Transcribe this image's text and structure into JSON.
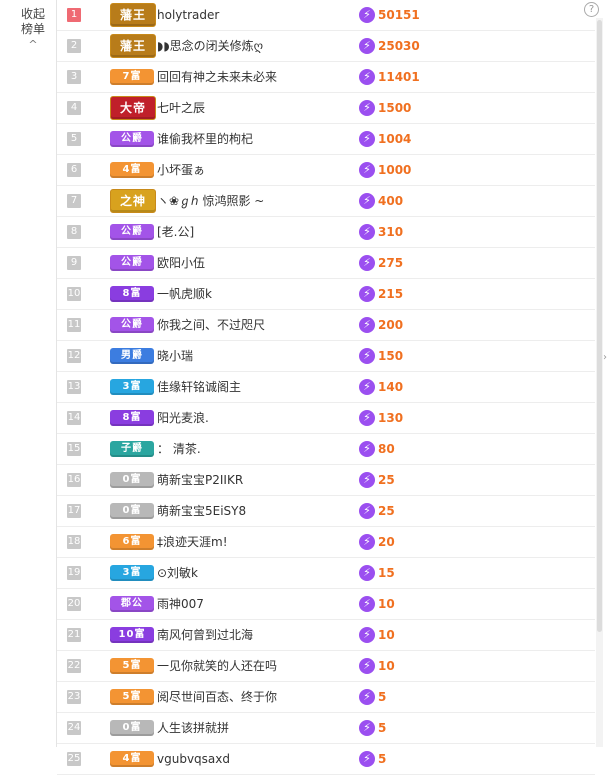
{
  "collapse": {
    "line1": "收起",
    "line2": "榜单",
    "chevron": "^"
  },
  "help_glyph": "?",
  "icons": {
    "help": "question-circle-icon",
    "value": "lightning-icon",
    "side": "chevron-right-icon",
    "collapse": "chevron-up-icon"
  },
  "colors": {
    "value_text": "#f07020",
    "top_rank": "#ef6a73",
    "rank": "#c8c8c8",
    "bolt": "#9b4ff0"
  },
  "ranking": [
    {
      "rank": "1",
      "badge": "藩王",
      "badge_color": "#b87c1a",
      "name": "holytrader",
      "value": "50151"
    },
    {
      "rank": "2",
      "badge": "藩王",
      "badge_color": "#b87c1a",
      "name": "◗◗思念の闭关修炼ღ",
      "value": "25030"
    },
    {
      "rank": "3",
      "badge": "7富",
      "badge_color": "#f39433",
      "name": "回回有神之未来未必来",
      "value": "11401"
    },
    {
      "rank": "4",
      "badge": "大帝",
      "badge_color": "#c0202a",
      "name": "七叶之辰",
      "value": "1500"
    },
    {
      "rank": "5",
      "badge": "公爵",
      "badge_color": "#a354e8",
      "name": "谁偷我杯里的枸杞",
      "value": "1004"
    },
    {
      "rank": "6",
      "badge": "4富",
      "badge_color": "#f39433",
      "name": "小坏蛋ぁ",
      "value": "1000"
    },
    {
      "rank": "7",
      "badge": "之神",
      "badge_color": "#d8a21e",
      "name": "ヽ❀ℊℎ 惊鸿照影 ~",
      "value": "400"
    },
    {
      "rank": "8",
      "badge": "公爵",
      "badge_color": "#a354e8",
      "name": "[老.公]",
      "value": "310"
    },
    {
      "rank": "9",
      "badge": "公爵",
      "badge_color": "#a354e8",
      "name": "欧阳小伍",
      "value": "275"
    },
    {
      "rank": "10",
      "badge": "8富",
      "badge_color": "#8a3de0",
      "name": "一帆虎顺k",
      "value": "215"
    },
    {
      "rank": "11",
      "badge": "公爵",
      "badge_color": "#a354e8",
      "name": "你我之间、不过咫尺",
      "value": "200"
    },
    {
      "rank": "12",
      "badge": "男爵",
      "badge_color": "#3c7de0",
      "name": "晓小瑞",
      "value": "150"
    },
    {
      "rank": "13",
      "badge": "3富",
      "badge_color": "#27a6e0",
      "name": "佳缘轩铭诚阁主",
      "value": "140"
    },
    {
      "rank": "14",
      "badge": "8富",
      "badge_color": "#8a3de0",
      "name": "阳光麦浪.",
      "value": "130"
    },
    {
      "rank": "15",
      "badge": "子爵",
      "badge_color": "#2ba6a0",
      "name": "：  清茶.",
      "value": "80"
    },
    {
      "rank": "16",
      "badge": "0富",
      "badge_color": "#b8b8b8",
      "name": "萌新宝宝P2IIKR",
      "value": "25"
    },
    {
      "rank": "17",
      "badge": "0富",
      "badge_color": "#b8b8b8",
      "name": "萌新宝宝5EiSY8",
      "value": "25"
    },
    {
      "rank": "18",
      "badge": "6富",
      "badge_color": "#f39433",
      "name": "‡浪迹天涯m!",
      "value": "20"
    },
    {
      "rank": "19",
      "badge": "3富",
      "badge_color": "#27a6e0",
      "name": "⊙刘敏k",
      "value": "15"
    },
    {
      "rank": "20",
      "badge": "郡公",
      "badge_color": "#a354e8",
      "name": "雨神007",
      "value": "10"
    },
    {
      "rank": "21",
      "badge": "10富",
      "badge_color": "#8a3de0",
      "name": "南风何曾到过北海",
      "value": "10"
    },
    {
      "rank": "22",
      "badge": "5富",
      "badge_color": "#f39433",
      "name": "一见你就笑的人还在吗",
      "value": "10"
    },
    {
      "rank": "23",
      "badge": "5富",
      "badge_color": "#f39433",
      "name": "阅尽世间百态、终于你",
      "value": "5"
    },
    {
      "rank": "24",
      "badge": "0富",
      "badge_color": "#b8b8b8",
      "name": "人生该拼就拼",
      "value": "5"
    },
    {
      "rank": "25",
      "badge": "4富",
      "badge_color": "#f39433",
      "name": "vgubvqsaxd",
      "value": "5"
    }
  ]
}
